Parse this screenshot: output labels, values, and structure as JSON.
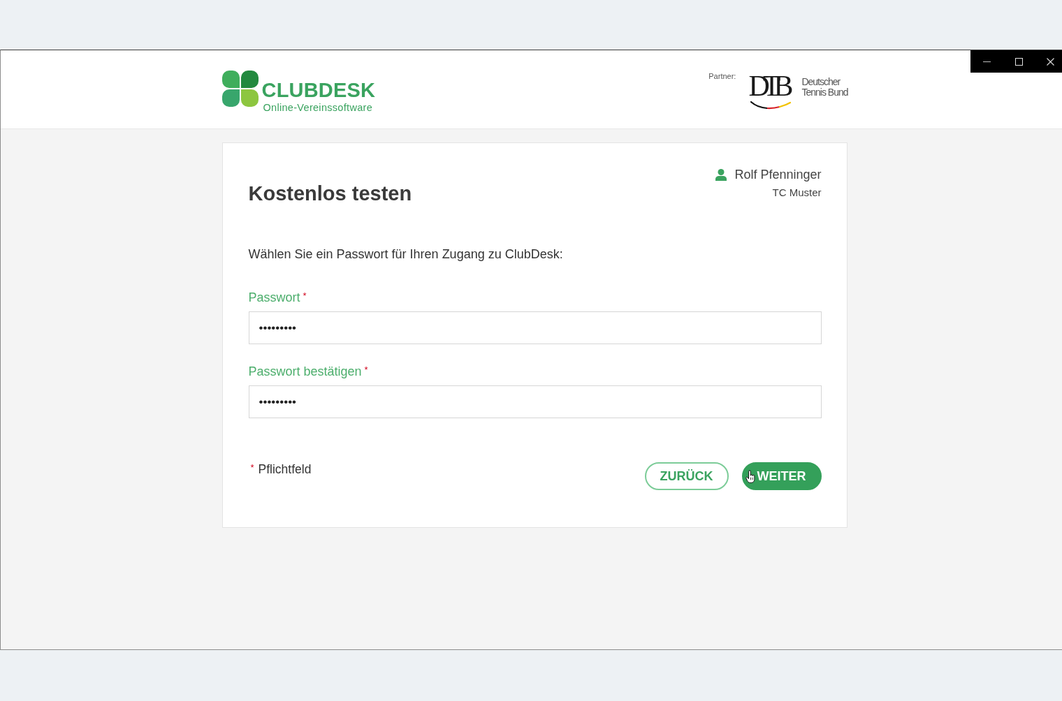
{
  "header": {
    "logo": {
      "wordmark": "CLUBDESK",
      "tagline": "Online-Vereinssoftware"
    },
    "partner": {
      "label": "Partner:",
      "wordmark": "DTB",
      "name_lines": [
        "Deutscher",
        "Tennis Bund"
      ]
    }
  },
  "card": {
    "title": "Kostenlos testen",
    "user": {
      "name": "Rolf Pfenninger",
      "club": "TC Muster"
    },
    "intro": "Wählen Sie ein Passwort für Ihren Zugang zu ClubDesk:",
    "fields": [
      {
        "label": "Passwort",
        "required_mark": "*",
        "value": "•••••••••"
      },
      {
        "label": "Passwort bestätigen",
        "required_mark": "*",
        "value": "•••••••••"
      }
    ],
    "required_note": {
      "mark": "*",
      "text": "Pflichtfeld"
    },
    "buttons": [
      {
        "label": "ZURÜCK",
        "kind": "outline"
      },
      {
        "label": "WEITER",
        "kind": "filled"
      }
    ]
  }
}
